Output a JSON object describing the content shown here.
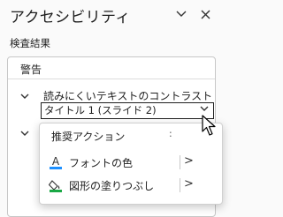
{
  "pane": {
    "title": "アクセシビリティ",
    "options_icon": "chevron-down-icon",
    "close_icon": "close-icon",
    "section_label": "検査結果"
  },
  "warnings": {
    "header": "警告",
    "issue": {
      "title": "読みにくいテキストのコントラスト",
      "selected_item": "タイトル 1 (スライド 2)"
    }
  },
  "context_menu": {
    "header": "推奨アクション",
    "header_trailing": ":",
    "items": [
      {
        "label": "フォントの色",
        "icon": "font-color-icon",
        "submenu": ">"
      },
      {
        "label": "図形の塗りつぶし",
        "icon": "shape-fill-icon",
        "submenu": ">"
      }
    ]
  },
  "colors": {
    "font_color_bar": "#1e90ff",
    "fill_bar": "#1aa845"
  }
}
